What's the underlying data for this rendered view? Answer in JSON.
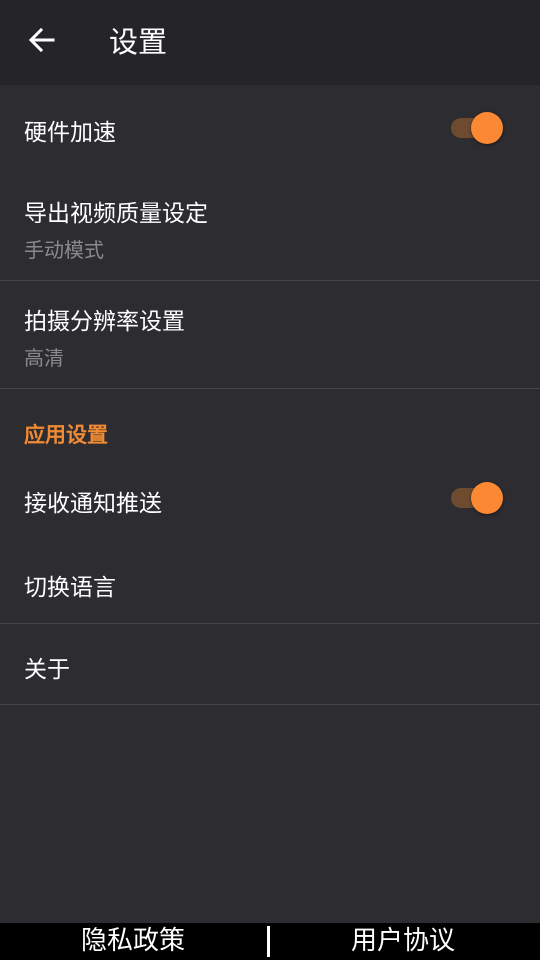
{
  "header": {
    "title": "设置",
    "back_icon": "arrow-left-icon"
  },
  "settings": {
    "hardware_accel": {
      "label": "硬件加速",
      "enabled": true
    },
    "export_quality": {
      "label": "导出视频质量设定",
      "value": "手动模式"
    },
    "capture_resolution": {
      "label": "拍摄分辨率设置",
      "value": "高清"
    }
  },
  "app_settings": {
    "section_title": "应用设置",
    "notifications": {
      "label": "接收通知推送",
      "enabled": true
    },
    "language": {
      "label": "切换语言"
    },
    "about": {
      "label": "关于"
    }
  },
  "footer": {
    "privacy": "隐私政策",
    "agreement": "用户协议"
  },
  "colors": {
    "background": "#2d2c31",
    "appbar": "#252428",
    "accent": "#fb8933",
    "toggle_track": "#6e4b2f",
    "secondary_text": "#8a898d",
    "divider": "#454449"
  }
}
